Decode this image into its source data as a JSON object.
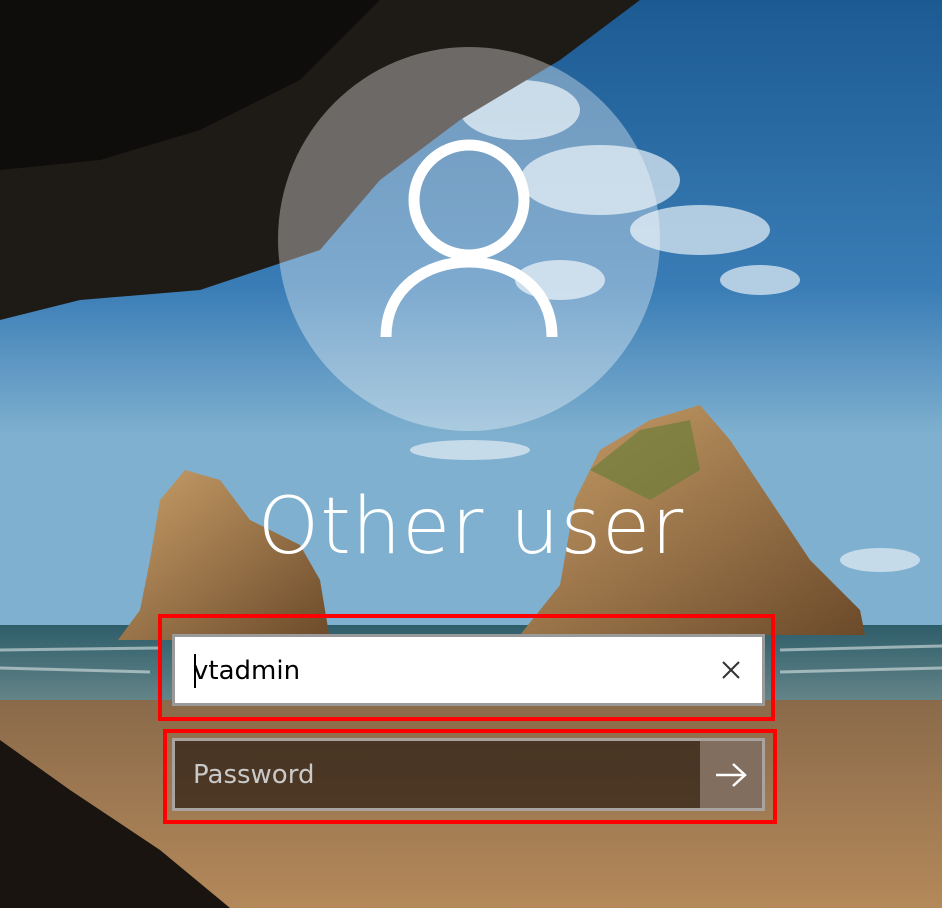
{
  "screen": {
    "title": "Other user",
    "user_icon": "user-silhouette-icon"
  },
  "username_field": {
    "value": "vtadmin",
    "clear_icon": "close-icon"
  },
  "password_field": {
    "placeholder": "Password",
    "submit_icon": "arrow-right-icon"
  },
  "colors": {
    "highlight": "#ff0000",
    "text": "#ffffff",
    "placeholder": "#c9c9c9"
  }
}
